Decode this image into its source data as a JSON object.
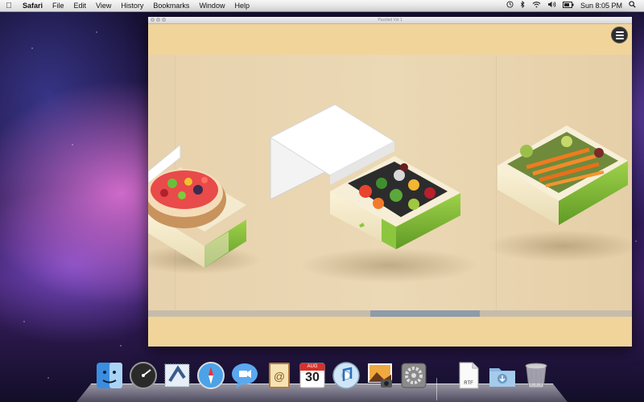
{
  "menubar": {
    "app_name": "Safari",
    "items": [
      "File",
      "Edit",
      "View",
      "History",
      "Bookmarks",
      "Window",
      "Help"
    ],
    "clock": "Sun 8:05 PM",
    "status_icons": [
      "time-machine-icon",
      "bluetooth-icon",
      "wifi-icon",
      "volume-icon",
      "battery-icon",
      "spotlight-icon"
    ]
  },
  "window": {
    "title": "Puzzled Vol 1"
  },
  "boxes": [
    {
      "name": "fruit-cake-box",
      "state": "open"
    },
    {
      "name": "vegetable-platter-box",
      "state": "open"
    },
    {
      "name": "carrots-box",
      "state": "closed"
    }
  ],
  "scroll": {
    "position_fraction": 0.5
  },
  "dock": {
    "items": [
      "finder-icon",
      "dashboard-icon",
      "mail-icon",
      "safari-icon",
      "ichat-icon",
      "address-book-icon",
      "ical-icon",
      "itunes-icon",
      "iphoto-icon",
      "system-preferences-icon",
      "rtf-document-icon",
      "downloads-folder-icon",
      "trash-icon"
    ],
    "ical_month": "AUG",
    "ical_day": "30",
    "rtf_label": "RTF"
  },
  "colors": {
    "band": "#f0d49a",
    "stage": "#e9d6ae",
    "box_green": "#8cc63f",
    "scroll_thumb": "#8d9bab"
  }
}
